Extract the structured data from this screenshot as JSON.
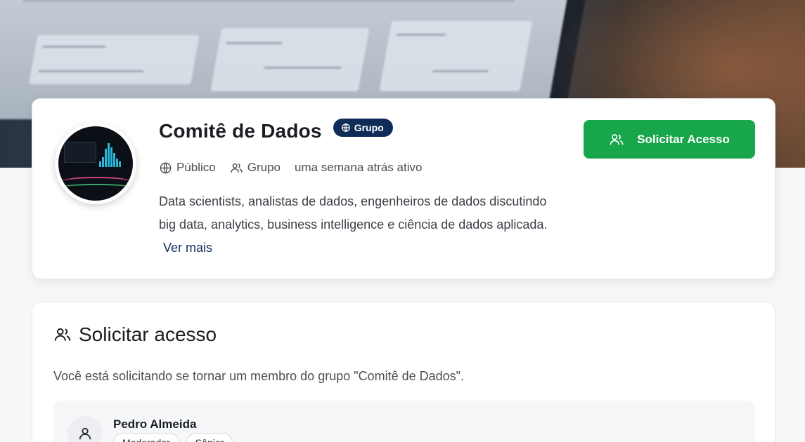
{
  "cover": {
    "icon": "dashboard-photo"
  },
  "group": {
    "title": "Comitê de Dados",
    "badge": "Grupo",
    "meta": {
      "visibility": "Público",
      "type": "Grupo",
      "activity": "uma semana atrás ativo"
    },
    "description": "Data scientists, analistas de dados, engenheiros de dados discutindo big data, analytics, business intelligence e ciência de dados aplicada.",
    "see_more": "Ver mais",
    "request_button": "Solicitar Acesso"
  },
  "request": {
    "title": "Solicitar acesso",
    "text": "Você está solicitando se tornar um membro do grupo \"Comitê de Dados\".",
    "member": {
      "name": "Pedro Almeida",
      "tags": [
        "Moderador",
        "Sênior"
      ]
    }
  },
  "colors": {
    "accent_green": "#18a64b",
    "badge_navy": "#0f2c58",
    "link": "#12305e"
  }
}
